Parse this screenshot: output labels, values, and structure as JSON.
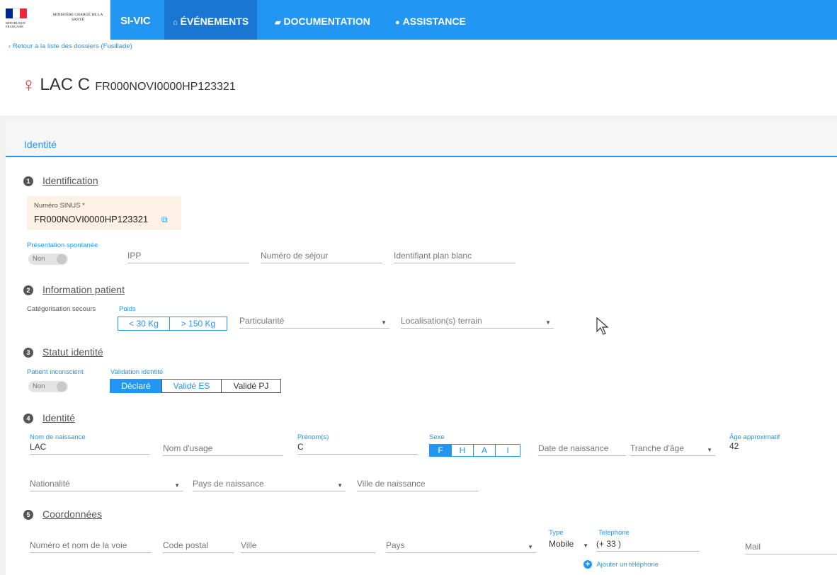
{
  "header": {
    "ministry": "MINISTÈRE CHARGÉ DE LA SANTÉ",
    "republic": "RÉPUBLIQUE FRANÇAISE",
    "brand": "SI-VIC",
    "nav": [
      {
        "label": "ÉVÉNEMENTS",
        "icon": "home-icon"
      },
      {
        "label": "DOCUMENTATION",
        "icon": "book-icon"
      },
      {
        "label": "ASSISTANCE",
        "icon": "chat-icon"
      }
    ]
  },
  "back_link": "Retour à la liste des dossiers (Fusillade)",
  "title": {
    "symbol": "♀",
    "name": "LAC C",
    "code": "FR000NOVI0000HP123321"
  },
  "panel": {
    "label": "Identité"
  },
  "sections": {
    "s1": {
      "num": "1",
      "title": "Identification"
    },
    "s2": {
      "num": "2",
      "title": "Information patient"
    },
    "s3": {
      "num": "3",
      "title": "Statut identité"
    },
    "s4": {
      "num": "4",
      "title": "Identité"
    },
    "s5": {
      "num": "5",
      "title": "Coordonnées"
    }
  },
  "identification": {
    "sinus_label": "Numéro SINUS *",
    "sinus_value": "FR000NOVI0000HP123321",
    "spontaneous_label": "Présentation spontanée",
    "spontaneous_value": "Non",
    "ipp": "IPP",
    "sejour": "Numéro de séjour",
    "plan_blanc": "Identifiant plan blanc"
  },
  "patient_info": {
    "categorisation": "Catégorisation secours",
    "poids_label": "Poids",
    "poids_options": [
      "< 30 Kg",
      "> 150 Kg"
    ],
    "particularite": "Particularité",
    "localisation": "Localisation(s) terrain"
  },
  "statut": {
    "inconscient_label": "Patient inconscient",
    "inconscient_value": "Non",
    "validation_label": "Validation identité",
    "validation_options": [
      "Déclaré",
      "Validé ES",
      "Validé PJ"
    ],
    "validation_selected": "Déclaré"
  },
  "identite": {
    "nom_naissance_label": "Nom de naissance",
    "nom_naissance_value": "LAC",
    "nom_usage": "Nom d'usage",
    "prenom_label": "Prénom(s)",
    "prenom_value": "C",
    "sexe_label": "Sexe",
    "sexe_options": [
      "F",
      "H",
      "A",
      "I"
    ],
    "sexe_selected": "F",
    "date_naissance": "Date de naissance",
    "tranche_age": "Tranche d'âge",
    "age_label": "Âge approximatif",
    "age_value": "42",
    "nationalite": "Nationalité",
    "pays_naissance": "Pays de naissance",
    "ville_naissance": "Ville de naissance"
  },
  "coordonnees": {
    "voie": "Numéro et nom de la voie",
    "code_postal": "Code postal",
    "ville": "Ville",
    "pays": "Pays",
    "type_label": "Type",
    "type_value": "Mobile",
    "telephone_label": "Telephone",
    "telephone_prefix": "(+ 33 )",
    "mail": "Mail",
    "add_phone": "Ajouter un téléphone"
  }
}
